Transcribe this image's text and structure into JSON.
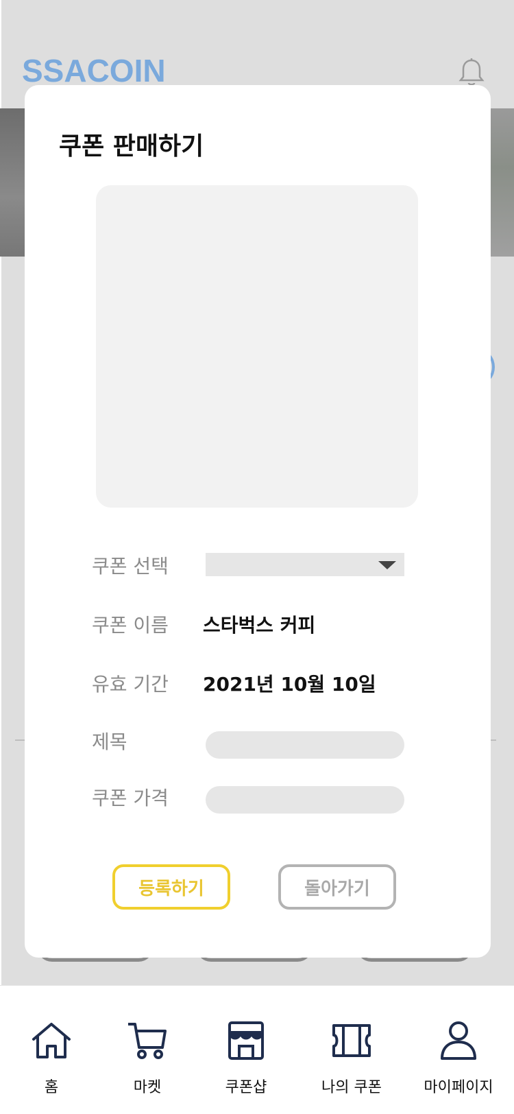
{
  "app": {
    "brand": "SSACOIN"
  },
  "modal": {
    "title": "쿠폰 판매하기",
    "rows": {
      "select_label": "쿠폰 선택",
      "name_label": "쿠폰 이름",
      "name_value": "스타벅스 커피",
      "expiry_label": "유효 기간",
      "expiry_value": "2021년 10월 10일",
      "subject_label": "제목",
      "price_label": "쿠폰 가격"
    },
    "inputs": {
      "subject_value": "",
      "price_value": ""
    },
    "buttons": {
      "register": "등록하기",
      "back": "돌아가기"
    }
  },
  "nav": {
    "items": [
      {
        "label": "홈",
        "icon": "home-icon"
      },
      {
        "label": "마켓",
        "icon": "cart-icon"
      },
      {
        "label": "쿠폰샵",
        "icon": "store-icon"
      },
      {
        "label": "나의 쿠폰",
        "icon": "ticket-icon"
      },
      {
        "label": "마이페이지",
        "icon": "user-icon"
      }
    ]
  },
  "colors": {
    "brand": "#7aa9dc",
    "register_accent": "#f0cf2e",
    "back_border": "#b3b3b3",
    "nav_icon": "#1f2d4d"
  }
}
